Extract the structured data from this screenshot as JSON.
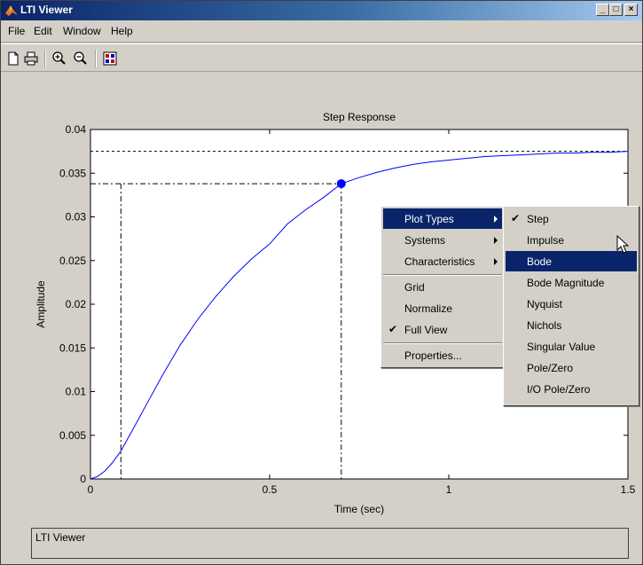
{
  "window": {
    "title": "LTI Viewer",
    "min_glyph": "_",
    "max_glyph": "□",
    "close_glyph": "×"
  },
  "menubar": {
    "items": [
      "File",
      "Edit",
      "Window",
      "Help"
    ]
  },
  "toolbar": {
    "icons": [
      "new-file-icon",
      "print-icon",
      "zoom-in-icon",
      "zoom-out-icon",
      "grid-view-icon"
    ]
  },
  "chart_data": {
    "type": "line",
    "title": "Step Response",
    "xlabel": "Time (sec)",
    "ylabel": "Amplitude",
    "xlim": [
      0,
      1.5
    ],
    "ylim": [
      0,
      0.04
    ],
    "xticks": [
      0,
      0.5,
      1,
      1.5
    ],
    "xtick_labels": [
      "0",
      "0.5",
      "1",
      "1.5"
    ],
    "yticks": [
      0,
      0.005,
      0.01,
      0.015,
      0.02,
      0.025,
      0.03,
      0.035,
      0.04
    ],
    "ytick_labels": [
      "0",
      "0.005",
      "0.01",
      "0.015",
      "0.02",
      "0.025",
      "0.03",
      "0.035",
      "0.04"
    ],
    "grid": false,
    "final_value": 0.0375,
    "marked_point": {
      "x": 0.7,
      "y": 0.0338
    },
    "characteristic_time": 0.085,
    "series": [
      {
        "color": "#0000ff",
        "x": [
          0,
          0.02,
          0.04,
          0.06,
          0.085,
          0.12,
          0.16,
          0.2,
          0.25,
          0.3,
          0.35,
          0.4,
          0.45,
          0.5,
          0.55,
          0.6,
          0.65,
          0.7,
          0.75,
          0.8,
          0.85,
          0.9,
          0.95,
          1.0,
          1.05,
          1.1,
          1.15,
          1.2,
          1.25,
          1.3,
          1.35,
          1.4,
          1.45,
          1.5
        ],
        "y": [
          0,
          0.0003,
          0.0009,
          0.0018,
          0.0032,
          0.0058,
          0.0088,
          0.0118,
          0.0153,
          0.0183,
          0.0209,
          0.0232,
          0.0252,
          0.0269,
          0.0292,
          0.0308,
          0.0322,
          0.0338,
          0.0345,
          0.0351,
          0.0356,
          0.036,
          0.0363,
          0.0365,
          0.0367,
          0.0369,
          0.037,
          0.0371,
          0.0372,
          0.0373,
          0.0373,
          0.0374,
          0.0374,
          0.0375
        ]
      }
    ]
  },
  "context_menu": {
    "items": [
      {
        "label": "Plot Types",
        "submenu": true,
        "selected": true
      },
      {
        "label": "Systems",
        "submenu": true
      },
      {
        "label": "Characteristics",
        "submenu": true
      },
      {
        "separator": true
      },
      {
        "label": "Grid"
      },
      {
        "label": "Normalize"
      },
      {
        "label": "Full View",
        "checked": true
      },
      {
        "separator": true
      },
      {
        "label": "Properties..."
      }
    ],
    "check_glyph": "✔"
  },
  "submenu": {
    "items": [
      {
        "label": "Step",
        "checked": true
      },
      {
        "label": "Impulse"
      },
      {
        "label": "Bode",
        "selected": true
      },
      {
        "label": "Bode Magnitude"
      },
      {
        "label": "Nyquist"
      },
      {
        "label": "Nichols"
      },
      {
        "label": "Singular Value"
      },
      {
        "label": "Pole/Zero"
      },
      {
        "label": "I/O Pole/Zero"
      }
    ]
  },
  "status": {
    "text": "LTI Viewer"
  }
}
